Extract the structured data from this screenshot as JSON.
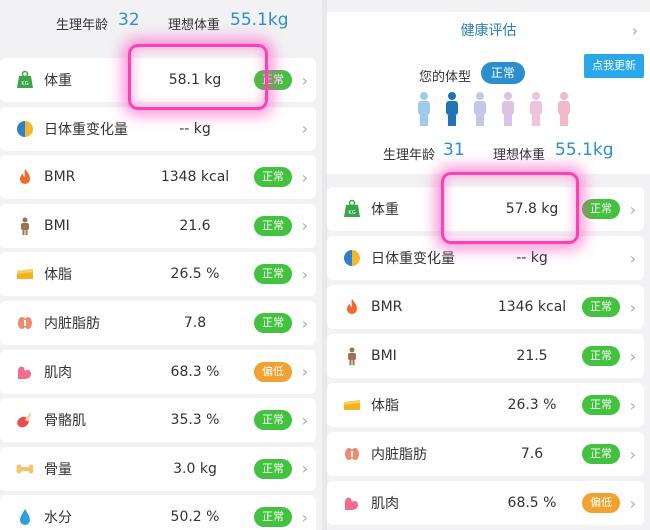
{
  "left": {
    "top_info": {
      "age_label": "生理年龄",
      "age_value": "32",
      "ideal_label": "理想体重",
      "ideal_value": "55.1kg"
    },
    "metrics": [
      {
        "label": "体重",
        "value": "58.1 kg",
        "badge": "正常",
        "badge_type": "ok",
        "icon": "scale-icon"
      },
      {
        "label": "日体重变化量",
        "value": "-- kg",
        "badge": "",
        "badge_type": "",
        "icon": "weight-change-icon"
      },
      {
        "label": "BMR",
        "value": "1348 kcal",
        "badge": "正常",
        "badge_type": "ok",
        "icon": "flame-icon"
      },
      {
        "label": "BMI",
        "value": "21.6",
        "badge": "正常",
        "badge_type": "ok",
        "icon": "person-icon"
      },
      {
        "label": "体脂",
        "value": "26.5 %",
        "badge": "正常",
        "badge_type": "ok",
        "icon": "body-fat-icon"
      },
      {
        "label": "内脏脂肪",
        "value": "7.8",
        "badge": "正常",
        "badge_type": "ok",
        "icon": "visceral-fat-icon"
      },
      {
        "label": "肌肉",
        "value": "68.3 %",
        "badge": "偏低",
        "badge_type": "low",
        "icon": "muscle-icon"
      },
      {
        "label": "骨骼肌",
        "value": "35.3 %",
        "badge": "正常",
        "badge_type": "ok",
        "icon": "skeletal-muscle-icon"
      },
      {
        "label": "骨量",
        "value": "3.0 kg",
        "badge": "正常",
        "badge_type": "ok",
        "icon": "bone-icon"
      },
      {
        "label": "水分",
        "value": "50.2 %",
        "badge": "正常",
        "badge_type": "ok",
        "icon": "water-drop-icon"
      }
    ]
  },
  "right": {
    "health_title": "健康评估",
    "body_type_label": "您的体型",
    "body_type_value": "正常",
    "more_button": "点我更新",
    "top_info": {
      "age_label": "生理年龄",
      "age_value": "31",
      "ideal_label": "理想体重",
      "ideal_value": "55.1kg"
    },
    "metrics": [
      {
        "label": "体重",
        "value": "57.8 kg",
        "badge": "正常",
        "badge_type": "ok",
        "icon": "scale-icon"
      },
      {
        "label": "日体重变化量",
        "value": "-- kg",
        "badge": "",
        "badge_type": "",
        "icon": "weight-change-icon"
      },
      {
        "label": "BMR",
        "value": "1346 kcal",
        "badge": "正常",
        "badge_type": "ok",
        "icon": "flame-icon"
      },
      {
        "label": "BMI",
        "value": "21.5",
        "badge": "正常",
        "badge_type": "ok",
        "icon": "person-icon"
      },
      {
        "label": "体脂",
        "value": "26.3 %",
        "badge": "正常",
        "badge_type": "ok",
        "icon": "body-fat-icon"
      },
      {
        "label": "内脏脂肪",
        "value": "7.6",
        "badge": "正常",
        "badge_type": "ok",
        "icon": "visceral-fat-icon"
      },
      {
        "label": "肌肉",
        "value": "68.5 %",
        "badge": "偏低",
        "badge_type": "low",
        "icon": "muscle-icon"
      }
    ]
  },
  "colors": {
    "accent": "#2b8fcf",
    "ok_badge": "#43c23f",
    "low_badge": "#f0a12f",
    "highlight": "#ff3fb4"
  }
}
